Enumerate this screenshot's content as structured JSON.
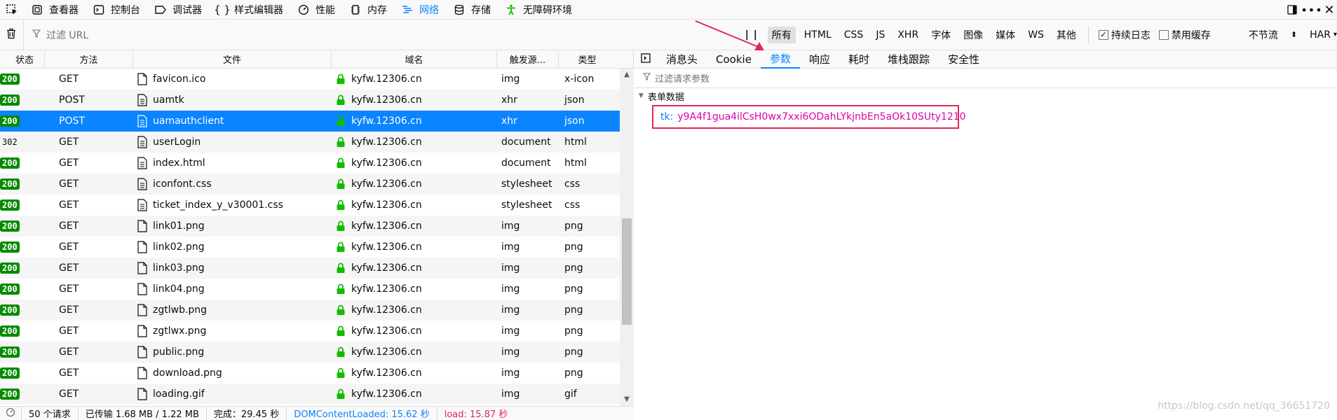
{
  "toolbar": {
    "tools": [
      {
        "label": "查看器",
        "icon": "inspector-icon"
      },
      {
        "label": "控制台",
        "icon": "console-icon"
      },
      {
        "label": "调试器",
        "icon": "debugger-icon"
      },
      {
        "label": "样式编辑器",
        "icon": "braces-icon"
      },
      {
        "label": "性能",
        "icon": "gauge-icon"
      },
      {
        "label": "内存",
        "icon": "memory-icon"
      },
      {
        "label": "网络",
        "icon": "network-icon"
      },
      {
        "label": "存储",
        "icon": "storage-icon"
      },
      {
        "label": "无障碍环境",
        "icon": "accessibility-icon"
      }
    ]
  },
  "filter": {
    "url_placeholder": "过滤 URL",
    "pause_glyph": "| |",
    "types": [
      "所有",
      "HTML",
      "CSS",
      "JS",
      "XHR",
      "字体",
      "图像",
      "媒体",
      "WS",
      "其他"
    ],
    "persist_logs": "持续日志",
    "disable_cache": "禁用缓存",
    "throttle": "不节流",
    "har": "HAR"
  },
  "table": {
    "headers": {
      "status": "状态",
      "method": "方法",
      "file": "文件",
      "domain": "域名",
      "cause": "触发源...",
      "type": "类型"
    },
    "rows": [
      {
        "status": "200",
        "method": "GET",
        "file": "favicon.ico",
        "domain": "kyfw.12306.cn",
        "cause": "img",
        "type": "x-icon"
      },
      {
        "status": "200",
        "method": "POST",
        "file": "uamtk",
        "domain": "kyfw.12306.cn",
        "cause": "xhr",
        "type": "json"
      },
      {
        "status": "200",
        "method": "POST",
        "file": "uamauthclient",
        "domain": "kyfw.12306.cn",
        "cause": "xhr",
        "type": "json"
      },
      {
        "status": "302",
        "method": "GET",
        "file": "userLogin",
        "domain": "kyfw.12306.cn",
        "cause": "document",
        "type": "html"
      },
      {
        "status": "200",
        "method": "GET",
        "file": "index.html",
        "domain": "kyfw.12306.cn",
        "cause": "document",
        "type": "html"
      },
      {
        "status": "200",
        "method": "GET",
        "file": "iconfont.css",
        "domain": "kyfw.12306.cn",
        "cause": "stylesheet",
        "type": "css"
      },
      {
        "status": "200",
        "method": "GET",
        "file": "ticket_index_y_v30001.css",
        "domain": "kyfw.12306.cn",
        "cause": "stylesheet",
        "type": "css"
      },
      {
        "status": "200",
        "method": "GET",
        "file": "link01.png",
        "domain": "kyfw.12306.cn",
        "cause": "img",
        "type": "png"
      },
      {
        "status": "200",
        "method": "GET",
        "file": "link02.png",
        "domain": "kyfw.12306.cn",
        "cause": "img",
        "type": "png"
      },
      {
        "status": "200",
        "method": "GET",
        "file": "link03.png",
        "domain": "kyfw.12306.cn",
        "cause": "img",
        "type": "png"
      },
      {
        "status": "200",
        "method": "GET",
        "file": "link04.png",
        "domain": "kyfw.12306.cn",
        "cause": "img",
        "type": "png"
      },
      {
        "status": "200",
        "method": "GET",
        "file": "zgtlwb.png",
        "domain": "kyfw.12306.cn",
        "cause": "img",
        "type": "png"
      },
      {
        "status": "200",
        "method": "GET",
        "file": "zgtlwx.png",
        "domain": "kyfw.12306.cn",
        "cause": "img",
        "type": "png"
      },
      {
        "status": "200",
        "method": "GET",
        "file": "public.png",
        "domain": "kyfw.12306.cn",
        "cause": "img",
        "type": "png"
      },
      {
        "status": "200",
        "method": "GET",
        "file": "download.png",
        "domain": "kyfw.12306.cn",
        "cause": "img",
        "type": "png"
      },
      {
        "status": "200",
        "method": "GET",
        "file": "loading.gif",
        "domain": "kyfw.12306.cn",
        "cause": "img",
        "type": "gif"
      }
    ],
    "selected_index": 2
  },
  "statusbar": {
    "requests": "50 个请求",
    "transferred": "已传输 1.68 MB / 1.22 MB",
    "finish": "完成：29.45 秒",
    "dom_loaded": "DOMContentLoaded: 15.62 秒",
    "load": "load: 15.87 秒"
  },
  "details": {
    "tabs": [
      "消息头",
      "Cookie",
      "参数",
      "响应",
      "耗时",
      "堆栈跟踪",
      "安全性"
    ],
    "active_tab": 2,
    "param_filter_placeholder": "过滤请求参数",
    "section_title": "表单数据",
    "param_key": "tk:",
    "param_value": "y9A4f1gua4ilCsH0wx7xxi6ODahLYkjnbEn5aOk10SUty1210"
  },
  "watermark": "https://blog.csdn.net/qq_36651720",
  "colors": {
    "accent": "#0a84ff",
    "status_ok": "#058b00",
    "annotation": "#e22850",
    "param_value": "#dd00a9"
  }
}
